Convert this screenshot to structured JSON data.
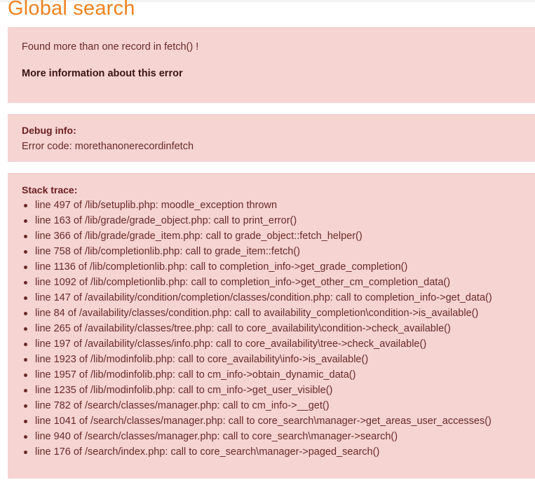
{
  "page": {
    "title": "Global search"
  },
  "error": {
    "message": "Found more than one record in fetch() !",
    "more_info_label": "More information about this error"
  },
  "debug": {
    "heading": "Debug info:",
    "error_code": "Error code: morethanonerecordinfetch"
  },
  "stack": {
    "heading": "Stack trace:",
    "lines": [
      "line 497 of /lib/setuplib.php: moodle_exception thrown",
      "line 163 of /lib/grade/grade_object.php: call to print_error()",
      "line 366 of /lib/grade/grade_item.php: call to grade_object::fetch_helper()",
      "line 758 of /lib/completionlib.php: call to grade_item::fetch()",
      "line 1136 of /lib/completionlib.php: call to completion_info->get_grade_completion()",
      "line 1092 of /lib/completionlib.php: call to completion_info->get_other_cm_completion_data()",
      "line 147 of /availability/condition/completion/classes/condition.php: call to completion_info->get_data()",
      "line 84 of /availability/classes/condition.php: call to availability_completion\\condition->is_available()",
      "line 265 of /availability/classes/tree.php: call to core_availability\\condition->check_available()",
      "line 197 of /availability/classes/info.php: call to core_availability\\tree->check_available()",
      "line 1923 of /lib/modinfolib.php: call to core_availability\\info->is_available()",
      "line 1957 of /lib/modinfolib.php: call to cm_info->obtain_dynamic_data()",
      "line 1235 of /lib/modinfolib.php: call to cm_info->get_user_visible()",
      "line 782 of /search/classes/manager.php: call to cm_info->__get()",
      "line 1041 of /search/classes/manager.php: call to core_search\\manager->get_areas_user_accesses()",
      "line 940 of /search/classes/manager.php: call to core_search\\manager->search()",
      "line 176 of /search/index.php: call to core_search\\manager->paged_search()"
    ]
  },
  "colors": {
    "title": "#f0821e",
    "alert_bg": "#f5d4d2",
    "alert_text": "#6a1e1e"
  }
}
